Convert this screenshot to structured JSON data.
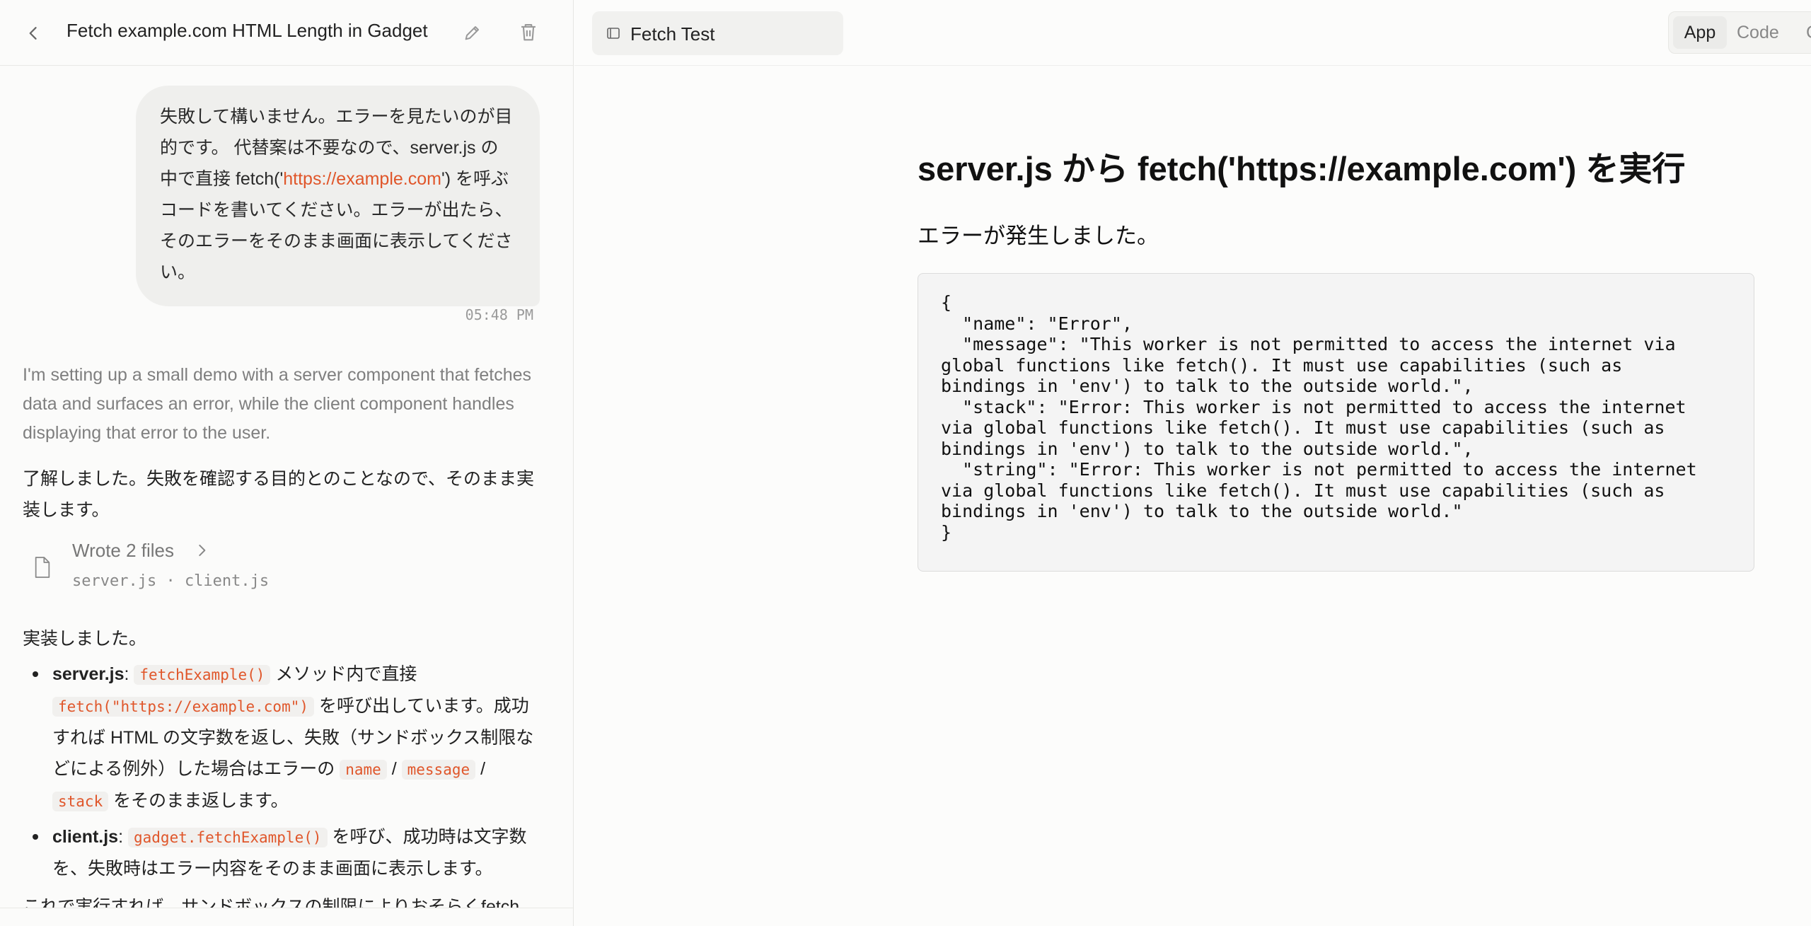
{
  "left": {
    "title": "Fetch example.com HTML Length in Gadget",
    "user_message": {
      "before_link": "失敗して構いません。エラーを見たいのが目的です。 代替案は不要なので、server.js の中で直接 fetch('",
      "link": "https://example.com",
      "after_link": "') を呼ぶコードを書いてください。エラーが出たら、そのエラーをそのまま画面に表示してください。",
      "time": "05:48 PM"
    },
    "thinking": "I'm setting up a small demo with a server component that fetches data and surfaces an error, while the client component handles displaying that error to the user.",
    "reply_intro": "了解しました。失敗を確認する目的とのことなので、そのまま実装します。",
    "files": {
      "label": "Wrote 2 files",
      "names": "server.js · client.js"
    },
    "done": "実装しました。",
    "bullets": [
      {
        "file": "server.js",
        "colon": ": ",
        "code1": "fetchExample()",
        "t1": " メソッド内で直接 ",
        "code2": "fetch(\"https://example.com\")",
        "t2": " を呼び出しています。成功すれば HTML の文字数を返し、失敗（サンドボックス制限などによる例外）した場合はエラーの ",
        "code3": "name",
        "sep1": " / ",
        "code4": "message",
        "sep2": " / ",
        "code5": "stack",
        "t3": " をそのまま返します。"
      },
      {
        "file": "client.js",
        "colon": ": ",
        "code1": "gadget.fetchExample()",
        "t1": " を呼び、成功時は文字数を、失敗時はエラー内容をそのまま画面に表示します。"
      }
    ],
    "cut_text": "これで実行すれば、サンドボックスの制限によりおそらくfetch"
  },
  "right": {
    "tab_label": "Fetch Test",
    "views": {
      "app": "App",
      "code": "Code",
      "more": "C"
    },
    "preview": {
      "heading": "server.js から fetch('https://example.com') を実行",
      "status": "エラーが発生しました。",
      "error_json": "{\n  \"name\": \"Error\",\n  \"message\": \"This worker is not permitted to access the internet via\nglobal functions like fetch(). It must use capabilities (such as\nbindings in 'env') to talk to the outside world.\",\n  \"stack\": \"Error: This worker is not permitted to access the internet\nvia global functions like fetch(). It must use capabilities (such as\nbindings in 'env') to talk to the outside world.\",\n  \"string\": \"Error: This worker is not permitted to access the internet\nvia global functions like fetch(). It must use capabilities (such as\nbindings in 'env') to talk to the outside world.\"\n}"
    }
  },
  "colors": {
    "accent": "#e0562a",
    "code_bg": "#f1f0ee"
  },
  "icons": [
    "chevron-left-icon",
    "pencil-icon",
    "trash-icon",
    "file-icon",
    "chevron-right-icon",
    "window-icon"
  ]
}
